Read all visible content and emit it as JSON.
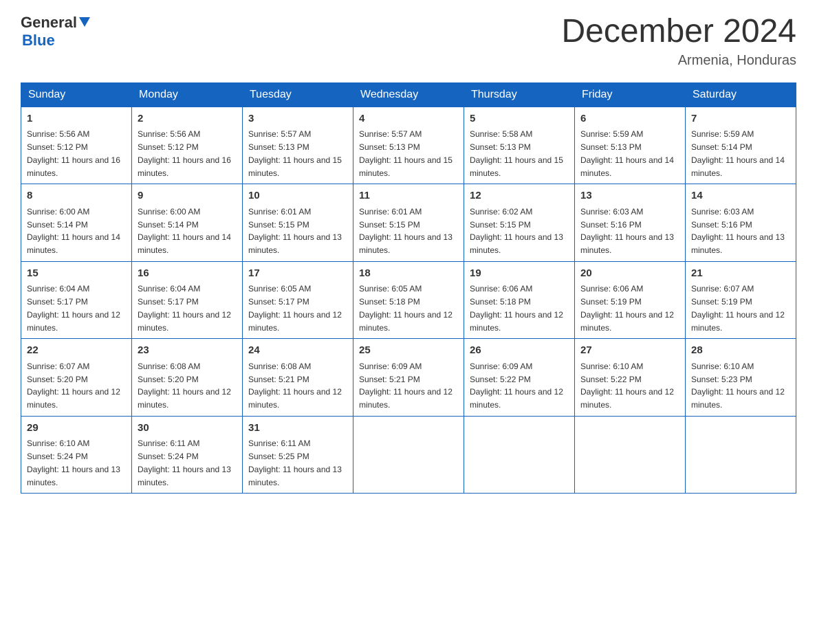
{
  "header": {
    "logo_general": "General",
    "logo_blue": "Blue",
    "title": "December 2024",
    "subtitle": "Armenia, Honduras"
  },
  "weekdays": [
    "Sunday",
    "Monday",
    "Tuesday",
    "Wednesday",
    "Thursday",
    "Friday",
    "Saturday"
  ],
  "weeks": [
    [
      {
        "day": "1",
        "sunrise": "5:56 AM",
        "sunset": "5:12 PM",
        "daylight": "11 hours and 16 minutes."
      },
      {
        "day": "2",
        "sunrise": "5:56 AM",
        "sunset": "5:12 PM",
        "daylight": "11 hours and 16 minutes."
      },
      {
        "day": "3",
        "sunrise": "5:57 AM",
        "sunset": "5:13 PM",
        "daylight": "11 hours and 15 minutes."
      },
      {
        "day": "4",
        "sunrise": "5:57 AM",
        "sunset": "5:13 PM",
        "daylight": "11 hours and 15 minutes."
      },
      {
        "day": "5",
        "sunrise": "5:58 AM",
        "sunset": "5:13 PM",
        "daylight": "11 hours and 15 minutes."
      },
      {
        "day": "6",
        "sunrise": "5:59 AM",
        "sunset": "5:13 PM",
        "daylight": "11 hours and 14 minutes."
      },
      {
        "day": "7",
        "sunrise": "5:59 AM",
        "sunset": "5:14 PM",
        "daylight": "11 hours and 14 minutes."
      }
    ],
    [
      {
        "day": "8",
        "sunrise": "6:00 AM",
        "sunset": "5:14 PM",
        "daylight": "11 hours and 14 minutes."
      },
      {
        "day": "9",
        "sunrise": "6:00 AM",
        "sunset": "5:14 PM",
        "daylight": "11 hours and 14 minutes."
      },
      {
        "day": "10",
        "sunrise": "6:01 AM",
        "sunset": "5:15 PM",
        "daylight": "11 hours and 13 minutes."
      },
      {
        "day": "11",
        "sunrise": "6:01 AM",
        "sunset": "5:15 PM",
        "daylight": "11 hours and 13 minutes."
      },
      {
        "day": "12",
        "sunrise": "6:02 AM",
        "sunset": "5:15 PM",
        "daylight": "11 hours and 13 minutes."
      },
      {
        "day": "13",
        "sunrise": "6:03 AM",
        "sunset": "5:16 PM",
        "daylight": "11 hours and 13 minutes."
      },
      {
        "day": "14",
        "sunrise": "6:03 AM",
        "sunset": "5:16 PM",
        "daylight": "11 hours and 13 minutes."
      }
    ],
    [
      {
        "day": "15",
        "sunrise": "6:04 AM",
        "sunset": "5:17 PM",
        "daylight": "11 hours and 12 minutes."
      },
      {
        "day": "16",
        "sunrise": "6:04 AM",
        "sunset": "5:17 PM",
        "daylight": "11 hours and 12 minutes."
      },
      {
        "day": "17",
        "sunrise": "6:05 AM",
        "sunset": "5:17 PM",
        "daylight": "11 hours and 12 minutes."
      },
      {
        "day": "18",
        "sunrise": "6:05 AM",
        "sunset": "5:18 PM",
        "daylight": "11 hours and 12 minutes."
      },
      {
        "day": "19",
        "sunrise": "6:06 AM",
        "sunset": "5:18 PM",
        "daylight": "11 hours and 12 minutes."
      },
      {
        "day": "20",
        "sunrise": "6:06 AM",
        "sunset": "5:19 PM",
        "daylight": "11 hours and 12 minutes."
      },
      {
        "day": "21",
        "sunrise": "6:07 AM",
        "sunset": "5:19 PM",
        "daylight": "11 hours and 12 minutes."
      }
    ],
    [
      {
        "day": "22",
        "sunrise": "6:07 AM",
        "sunset": "5:20 PM",
        "daylight": "11 hours and 12 minutes."
      },
      {
        "day": "23",
        "sunrise": "6:08 AM",
        "sunset": "5:20 PM",
        "daylight": "11 hours and 12 minutes."
      },
      {
        "day": "24",
        "sunrise": "6:08 AM",
        "sunset": "5:21 PM",
        "daylight": "11 hours and 12 minutes."
      },
      {
        "day": "25",
        "sunrise": "6:09 AM",
        "sunset": "5:21 PM",
        "daylight": "11 hours and 12 minutes."
      },
      {
        "day": "26",
        "sunrise": "6:09 AM",
        "sunset": "5:22 PM",
        "daylight": "11 hours and 12 minutes."
      },
      {
        "day": "27",
        "sunrise": "6:10 AM",
        "sunset": "5:22 PM",
        "daylight": "11 hours and 12 minutes."
      },
      {
        "day": "28",
        "sunrise": "6:10 AM",
        "sunset": "5:23 PM",
        "daylight": "11 hours and 12 minutes."
      }
    ],
    [
      {
        "day": "29",
        "sunrise": "6:10 AM",
        "sunset": "5:24 PM",
        "daylight": "11 hours and 13 minutes."
      },
      {
        "day": "30",
        "sunrise": "6:11 AM",
        "sunset": "5:24 PM",
        "daylight": "11 hours and 13 minutes."
      },
      {
        "day": "31",
        "sunrise": "6:11 AM",
        "sunset": "5:25 PM",
        "daylight": "11 hours and 13 minutes."
      },
      null,
      null,
      null,
      null
    ]
  ]
}
